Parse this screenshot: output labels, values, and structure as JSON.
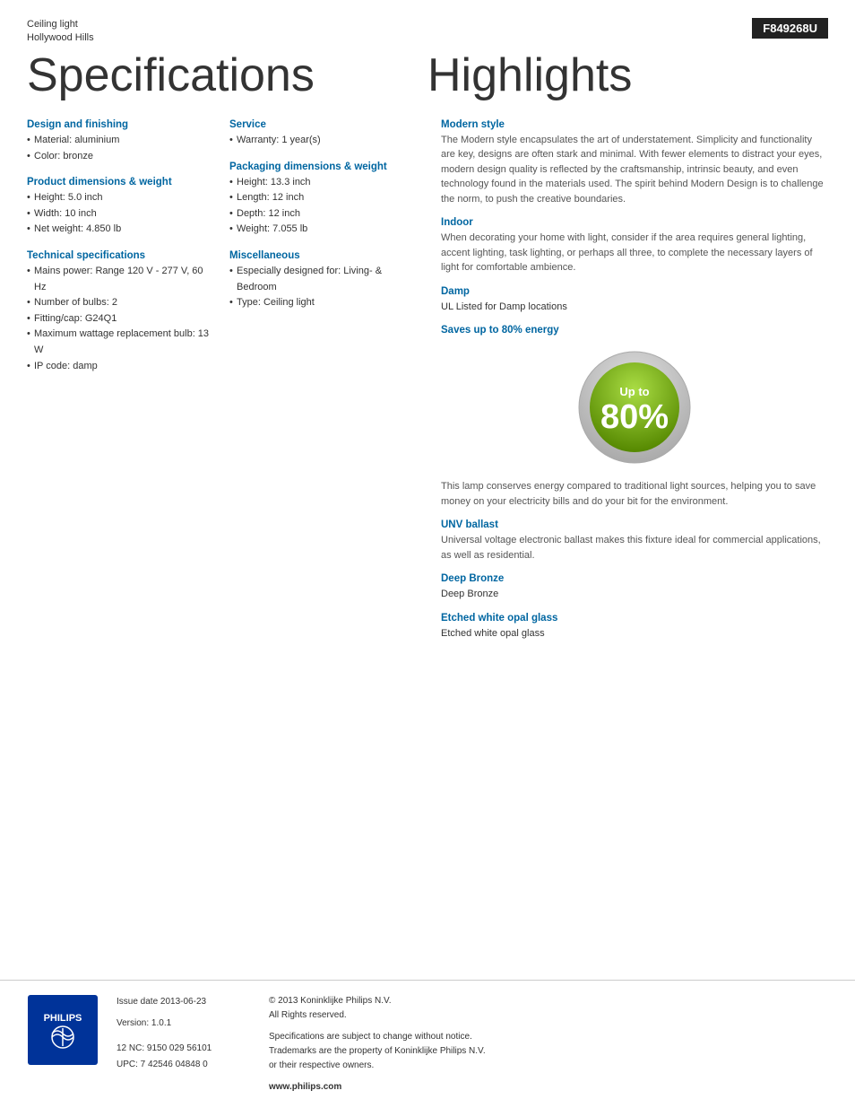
{
  "header": {
    "product_type": "Ceiling light",
    "product_name": "Hollywood Hills",
    "model": "F849268U"
  },
  "titles": {
    "specs": "Specifications",
    "highlights": "Highlights"
  },
  "specs": {
    "design_finishing": {
      "title": "Design and finishing",
      "items": [
        "Material: aluminium",
        "Color: bronze"
      ]
    },
    "product_dimensions": {
      "title": "Product dimensions & weight",
      "items": [
        "Height: 5.0 inch",
        "Width: 10 inch",
        "Net weight: 4.850 lb"
      ]
    },
    "technical": {
      "title": "Technical specifications",
      "items": [
        "Mains power: Range 120 V - 277 V, 60 Hz",
        "Number of bulbs: 2",
        "Fitting/cap: G24Q1",
        "Maximum wattage replacement bulb: 13 W",
        "IP code: damp"
      ]
    },
    "service": {
      "title": "Service",
      "items": [
        "Warranty: 1 year(s)"
      ]
    },
    "packaging": {
      "title": "Packaging dimensions & weight",
      "items": [
        "Height: 13.3 inch",
        "Length: 12 inch",
        "Depth: 12 inch",
        "Weight: 7.055 lb"
      ]
    },
    "miscellaneous": {
      "title": "Miscellaneous",
      "items": [
        "Especially designed for: Living- & Bedroom",
        "Type: Ceiling light"
      ]
    }
  },
  "highlights": {
    "modern_style": {
      "title": "Modern style",
      "text": "The Modern style encapsulates the art of understatement. Simplicity and functionality are key, designs are often stark and minimal. With fewer elements to distract your eyes, modern design quality is reflected by the craftsmanship, intrinsic beauty, and even technology found in the materials used. The spirit behind Modern Design is to challenge the norm, to push the creative boundaries."
    },
    "indoor": {
      "title": "Indoor",
      "text": "When decorating your home with light, consider if the area requires general lighting, accent lighting, task lighting, or perhaps all three, to complete the necessary layers of light for comfortable ambience."
    },
    "damp": {
      "title": "Damp",
      "text": "UL Listed for Damp locations"
    },
    "saves_energy": {
      "title": "Saves up to 80% energy",
      "badge_up_to": "Up to",
      "badge_percent": "80%",
      "energy_text": "This lamp conserves energy compared to traditional light sources, helping you to save money on your electricity bills and do your bit for the environment."
    },
    "unv_ballast": {
      "title": "UNV ballast",
      "text": "Universal voltage electronic ballast makes this fixture ideal for commercial applications, as well as residential."
    },
    "deep_bronze": {
      "title": "Deep Bronze",
      "text": "Deep Bronze"
    },
    "etched_glass": {
      "title": "Etched white opal glass",
      "text": "Etched white opal glass"
    }
  },
  "footer": {
    "issue_date_label": "Issue date 2013-06-23",
    "version_label": "Version: 1.0.1",
    "nc_upc": "12 NC: 9150 029 56101\nUPC: 7 42546 04848 0",
    "copyright": "© 2013 Koninklijke Philips N.V.\nAll Rights reserved.",
    "disclaimer": "Specifications are subject to change without notice.\nTrademarks are the property of Koninklijke Philips N.V.\nor their respective owners.",
    "website": "www.philips.com"
  }
}
